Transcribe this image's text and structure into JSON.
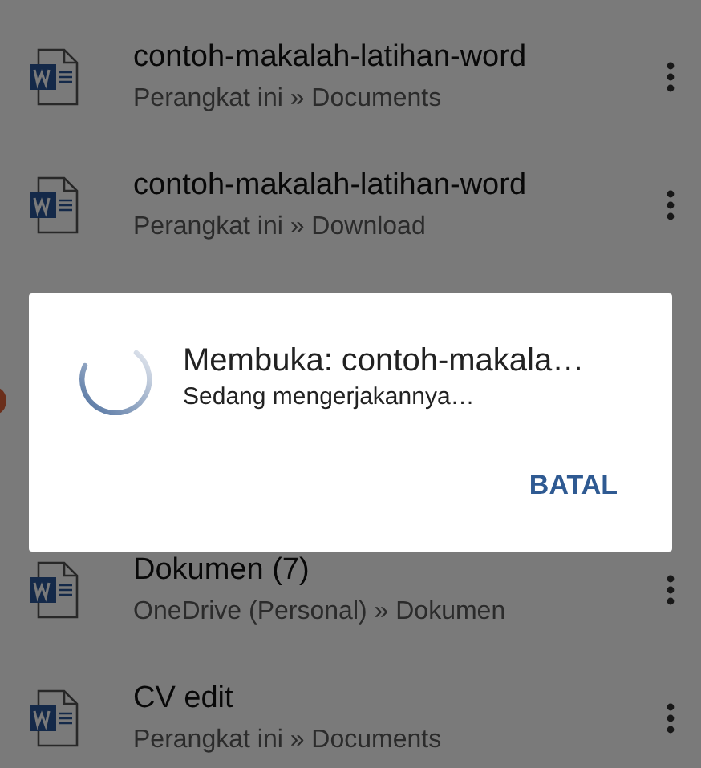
{
  "recent_files": [
    {
      "title": "contoh-makalah-latihan-word",
      "location": "Perangkat ini » Documents"
    },
    {
      "title": "contoh-makalah-latihan-word",
      "location": "Perangkat ini » Download"
    },
    {
      "hidden": true
    },
    {
      "hidden": true
    },
    {
      "title": "Dokumen (7)",
      "location": "OneDrive (Personal) » Dokumen"
    },
    {
      "title": "CV edit",
      "location": "Perangkat ini » Documents"
    }
  ],
  "dialog": {
    "title": "Membuka: contoh-makala…",
    "message": "Sedang mengerjakannya…",
    "button": "BATAL"
  }
}
